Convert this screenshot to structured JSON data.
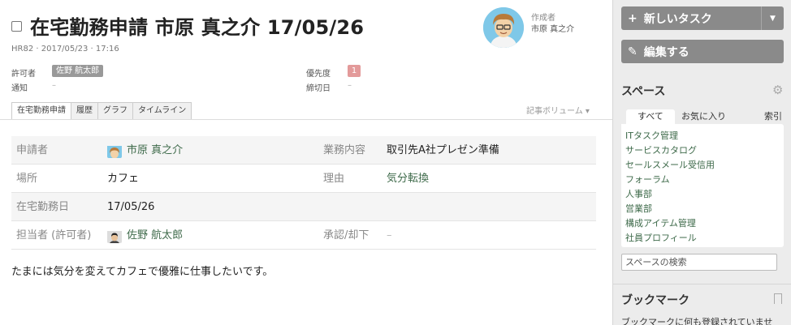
{
  "task": {
    "title": "在宅勤務申請 市原 真之介 17/05/26",
    "subtitle": "HR82 · 2017/05/23 · 17:16",
    "creator_label": "作成者",
    "creator_name": "市原 真之介"
  },
  "meta": {
    "approver_label": "許可者",
    "approver_value": "佐野 航太郎",
    "notify_label": "通知",
    "notify_value": "–",
    "priority_label": "優先度",
    "priority_value": "1",
    "deadline_label": "締切日",
    "deadline_value": "–"
  },
  "tabs": [
    {
      "label": "在宅勤務申請"
    },
    {
      "label": "履歴"
    },
    {
      "label": "グラフ"
    },
    {
      "label": "タイムライン"
    }
  ],
  "volume_label": "記事ボリューム",
  "fields": {
    "r1": {
      "l1": "申請者",
      "v1": "市原 真之介",
      "l2": "業務内容",
      "v2": "取引先A社プレゼン準備"
    },
    "r2": {
      "l1": "場所",
      "v1": "カフェ",
      "l2": "理由",
      "v2": "気分転換"
    },
    "r3": {
      "l1": "在宅勤務日",
      "v1": "17/05/26"
    },
    "r4": {
      "l1": "担当者 (許可者)",
      "v1": "佐野 航太郎",
      "l2": "承認/却下",
      "v2": "–"
    }
  },
  "body_text": "たまには気分を変えてカフェで優雅に仕事したいです。",
  "sidebar": {
    "new_task": "新しいタスク",
    "edit": "編集する",
    "spaces_title": "スペース",
    "space_tabs": {
      "all": "すべて",
      "favorites": "お気に入り",
      "index": "索引"
    },
    "spaces": [
      "ITタスク管理",
      "サービスカタログ",
      "セールスメール受信用",
      "フォーラム",
      "人事部",
      "営業部",
      "構成アイテム管理",
      "社員プロフィール"
    ],
    "space_search_placeholder": "スペースの検索",
    "bookmark_title": "ブックマーク",
    "bookmark_empty": "ブックマークに何も登録されていませ"
  },
  "colors": {
    "link": "#3e6a4a",
    "button": "#8a8a8a",
    "priority": "#e39a9a"
  }
}
